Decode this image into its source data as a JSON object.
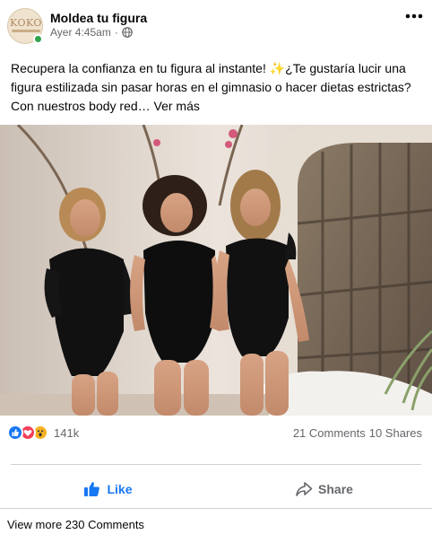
{
  "post": {
    "page_name": "Moldea tu figura",
    "timestamp": "Ayer 4:45am",
    "separator": "·",
    "avatar_text": "KOKO",
    "text": "Recupera la confianza en tu figura al instante! ✨¿Te gustaría lucir una figura estilizada sin pasar horas en el gimnasio o hacer dietas estrictas? Con nuestros body red…",
    "see_more": "Ver más"
  },
  "stats": {
    "reaction_count": "141k",
    "comments": "21 Comments",
    "shares": "10 Shares"
  },
  "actions": {
    "like": "Like",
    "share": "Share"
  },
  "footer": {
    "view_more": "View more 230 Comments"
  },
  "icons": {
    "globe": "globe-icon",
    "more": "more-options-icon",
    "like": "thumbs-up-icon",
    "share": "share-arrow-icon",
    "reactions": [
      "like-reaction-icon",
      "love-reaction-icon",
      "wow-reaction-icon"
    ]
  },
  "colors": {
    "accent": "#1877f2",
    "secondary_text": "#65676b",
    "online": "#31a24c",
    "love": "#f33e58",
    "wow": "#f7b125"
  }
}
